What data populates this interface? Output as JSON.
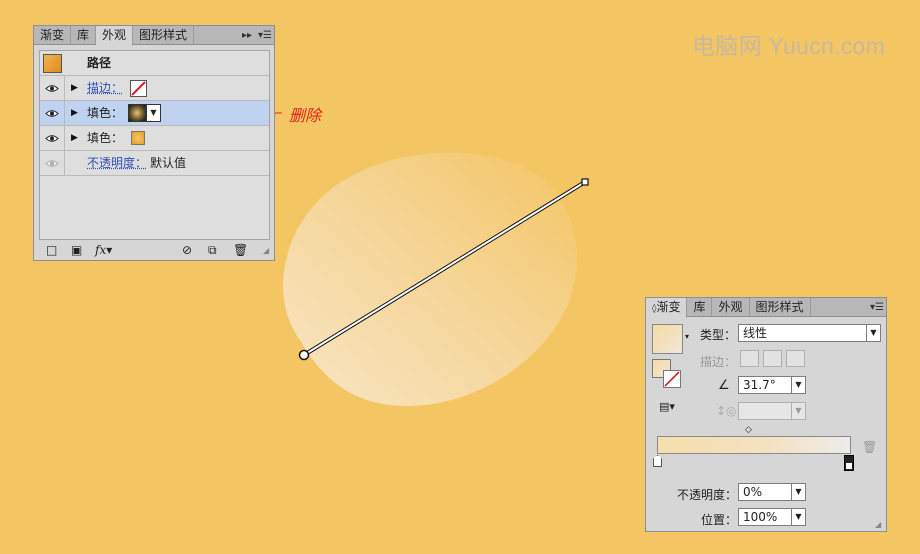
{
  "watermark": "电脑网 Yuucn.com",
  "annotation": {
    "label": "删除",
    "color": "#e0231c"
  },
  "appearance_panel": {
    "tabs": [
      "渐变",
      "库",
      "外观",
      "图形样式"
    ],
    "active_tab": "外观",
    "header_title": "路径",
    "rows": {
      "stroke_label": "描边：",
      "fill1_label": "填色：",
      "fill2_label": "填色：",
      "opacity_label": "不透明度：",
      "opacity_value": "默认值"
    }
  },
  "gradient_panel": {
    "tabs": [
      "渐变",
      "库",
      "外观",
      "图形样式"
    ],
    "active_tab": "渐变",
    "type_label": "类型：",
    "type_value": "线性",
    "stroke_label": "描边：",
    "angle_value": "31.7°",
    "opacity_label": "不透明度：",
    "opacity_value": "0%",
    "location_label": "位置：",
    "location_value": "100%"
  },
  "colors": {
    "background": "#f4c563",
    "panel": "#d6d6d6",
    "selected_row": "#bfd2ef",
    "link": "#2f4fb7"
  }
}
